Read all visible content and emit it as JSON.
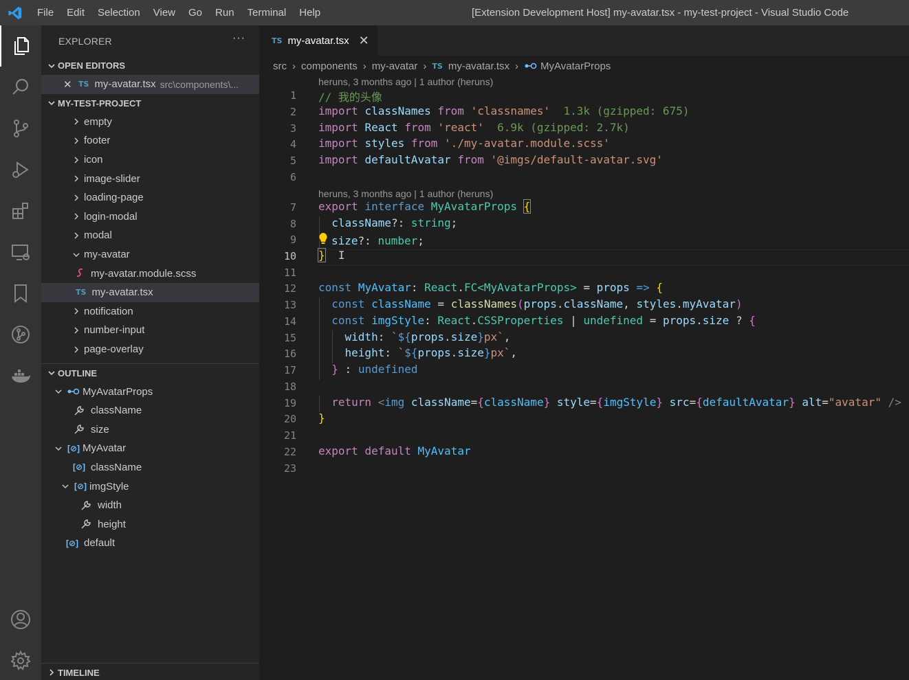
{
  "titlebar": {
    "menu": [
      "File",
      "Edit",
      "Selection",
      "View",
      "Go",
      "Run",
      "Terminal",
      "Help"
    ],
    "title": "[Extension Development Host] my-avatar.tsx - my-test-project - Visual Studio Code",
    "accent": "#007acc"
  },
  "activitybar": {
    "icons": [
      "files-icon",
      "search-icon",
      "source-control-icon",
      "run-debug-icon",
      "extensions-icon",
      "remote-explorer-icon",
      "bookmarks-icon",
      "git-graph-icon",
      "docker-icon",
      "account-icon",
      "settings-gear-icon"
    ]
  },
  "sidebar": {
    "title": "EXPLORER",
    "more": "···",
    "open_editors": {
      "header": "OPEN EDITORS",
      "file_badge": "TS",
      "file_name": "my-avatar.tsx",
      "file_path": "src\\components\\..."
    },
    "project": {
      "header": "MY-TEST-PROJECT",
      "folders_before": [
        "empty",
        "footer",
        "icon",
        "image-slider",
        "loading-page",
        "login-modal",
        "modal"
      ],
      "open_folder": "my-avatar",
      "children": [
        {
          "badge": "",
          "name": "my-avatar.module.scss"
        },
        {
          "badge": "TS",
          "name": "my-avatar.tsx"
        }
      ],
      "folders_after": [
        "notification",
        "number-input",
        "page-overlay"
      ]
    },
    "outline": {
      "header": "OUTLINE",
      "items": {
        "props": "MyAvatarProps",
        "classname_prop": "className",
        "size_prop": "size",
        "component": "MyAvatar",
        "classname_var": "className",
        "imgstyle": "imgStyle",
        "width": "width",
        "height": "height",
        "default": "default"
      }
    },
    "timeline": {
      "header": "TIMELINE"
    }
  },
  "editor": {
    "tab": {
      "badge": "TS",
      "name": "my-avatar.tsx",
      "close": "✕"
    },
    "breadcrumb": {
      "parts": [
        "src",
        "components",
        "my-avatar"
      ],
      "file_badge": "TS",
      "file": "my-avatar.tsx",
      "symbol": "MyAvatarProps"
    },
    "blame1": "heruns, 3 months ago | 1 author (heruns)",
    "blame2": "heruns, 3 months ago | 1 author (heruns)",
    "line_numbers": [
      "1",
      "2",
      "3",
      "4",
      "5",
      "6",
      "7",
      "8",
      "9",
      "10",
      "11",
      "12",
      "13",
      "14",
      "15",
      "16",
      "17",
      "18",
      "19",
      "20",
      "21",
      "22",
      "23"
    ],
    "current_line": "10",
    "tokens": {
      "l1_comment": "// 我的头像",
      "kw_import": "import",
      "kw_from": "from",
      "l2_name": "classNames",
      "l2_str": "'classnames'",
      "l2_size": "1.3k (gzipped: 675)",
      "l3_name": "React",
      "l3_str": "'react'",
      "l3_size": "6.9k (gzipped: 2.7k)",
      "l4_name": "styles",
      "l4_str": "'./my-avatar.module.scss'",
      "l5_name": "defaultAvatar",
      "l5_str": "'@imgs/default-avatar.svg'",
      "kw_export": "export",
      "kw_interface": "interface",
      "iface_name": "MyAvatarProps",
      "l8_prop": "className",
      "l8_opt": "?: ",
      "l8_type": "string",
      "l9_prop": "size",
      "l9_type": "number",
      "kw_const": "const",
      "l12_name": "MyAvatar",
      "l12_react": "React",
      "l12_fc": "FC",
      "l12_generic": "MyAvatarProps",
      "l12_props": "props",
      "l13_name": "className",
      "l13_fn": "classNames",
      "l13_props": "props",
      "l13_prop": "className",
      "l13_styles": "styles",
      "l13_member": "myAvatar",
      "l14_name": "imgStyle",
      "l14_react": "React",
      "l14_type": "CSSProperties",
      "l14_undef": "undefined",
      "l14_props": "props",
      "l14_size": "size",
      "l15_key": "width",
      "l16_key": "height",
      "tpl_props": "props",
      "tpl_size": "size",
      "tpl_px": "px",
      "l17_undef": "undefined",
      "kw_return": "return",
      "l19_tag": "img",
      "attr_class": "className",
      "attr_class_val": "className",
      "attr_style": "style",
      "attr_style_val": "imgStyle",
      "attr_src": "src",
      "attr_src_val": "defaultAvatar",
      "attr_alt": "alt",
      "attr_alt_val": "\"avatar\"",
      "kw_default": "default",
      "l22_name": "MyAvatar"
    }
  }
}
